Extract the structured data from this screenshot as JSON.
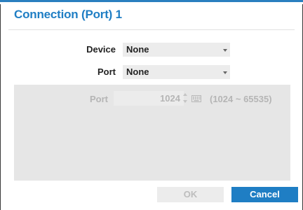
{
  "dialog": {
    "title": "Connection (Port) 1",
    "accent_color": "#1f7ec4"
  },
  "device": {
    "label": "Device",
    "value": "None"
  },
  "port_select": {
    "label": "Port",
    "value": "None"
  },
  "port_settings": {
    "label": "Port",
    "value": "1024",
    "range": "(1024 ~ 65535)",
    "spinner_icon": "spinner-icon",
    "keyboard_icon": "keyboard-icon",
    "state": "disabled"
  },
  "buttons": {
    "ok": "OK",
    "cancel": "Cancel"
  }
}
